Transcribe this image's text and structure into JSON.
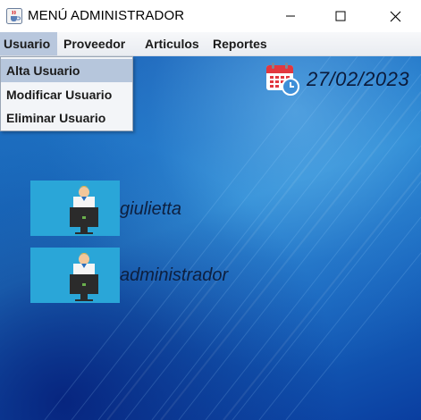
{
  "window": {
    "title": "MENÚ ADMINISTRADOR",
    "icon": "java-cup-icon",
    "controls": [
      "minimize-icon",
      "maximize-icon",
      "close-icon"
    ]
  },
  "menubar": {
    "items": [
      {
        "label": "Usuario",
        "active": true
      },
      {
        "label": "Proveedor"
      },
      {
        "label": "Articulos"
      },
      {
        "label": "Reportes"
      }
    ]
  },
  "dropdown": {
    "items": [
      {
        "label": "Alta Usuario",
        "selected": true
      },
      {
        "label": "Modificar Usuario"
      },
      {
        "label": "Eliminar Usuario"
      }
    ]
  },
  "date": {
    "icon": "calendar-clock-icon",
    "value": "27/02/2023"
  },
  "users": [
    {
      "name": "giulietta",
      "icon": "user-computer-icon"
    },
    {
      "name": "administrador",
      "icon": "user-computer-icon"
    }
  ],
  "colors": {
    "menu_highlight": "#b8c7dd",
    "tile": "#2aa6d8",
    "background_blue": "#1e78c8"
  }
}
